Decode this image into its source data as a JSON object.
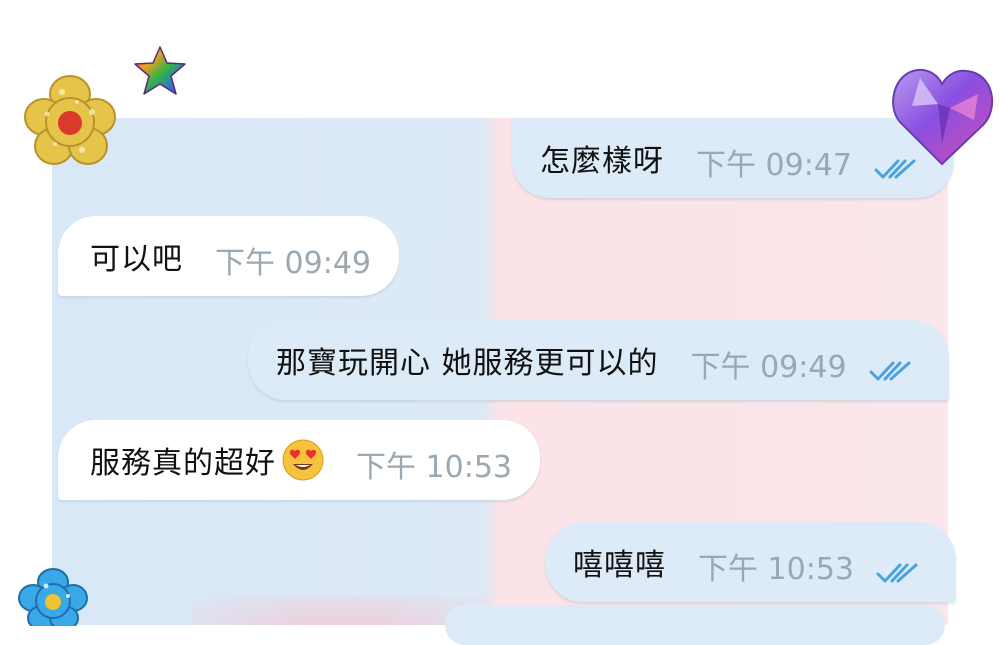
{
  "messages": [
    {
      "text": "怎麼樣呀",
      "time": "下午 09:47",
      "direction": "out",
      "read": true
    },
    {
      "text": "可以吧",
      "time": "下午 09:49",
      "direction": "in",
      "read": false
    },
    {
      "text": "那寶玩開心 她服務更可以的",
      "time": "下午 09:49",
      "direction": "out",
      "read": true
    },
    {
      "text": "服務真的超好",
      "emoji": "heart-eyes-emoji",
      "time": "下午 10:53",
      "direction": "in",
      "read": false
    },
    {
      "text": "嘻嘻嘻",
      "time": "下午 10:53",
      "direction": "out",
      "read": true
    }
  ],
  "colors": {
    "outgoing_bubble": "#dcebf7",
    "incoming_bubble": "#ffffff",
    "read_check": "#4aa3e0",
    "time_text": "#9aa8b4"
  },
  "decorations": [
    "gold-flower-sticker",
    "rainbow-star-sticker",
    "purple-heart-gem-sticker",
    "blue-flower-sticker"
  ]
}
